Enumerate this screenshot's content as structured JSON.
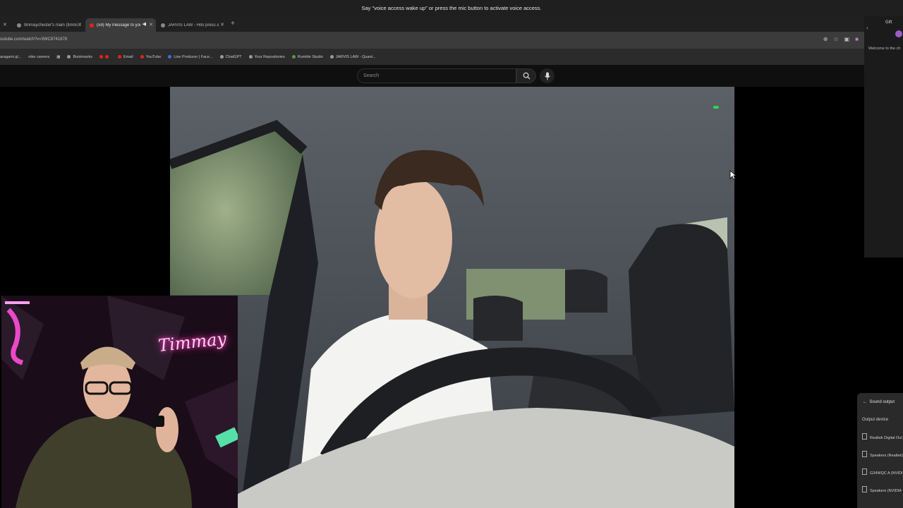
{
  "voice_bar": {
    "text": "Say \"voice access wake up\" or press the mic button to activate voice access."
  },
  "browser": {
    "tabs": [
      {
        "label": "timmaychester's main (timmi...",
        "active": false
      },
      {
        "label": "(59) My message to young ...",
        "active": true
      },
      {
        "label": "JARVIS LAW - Hito press at de...",
        "active": false
      }
    ],
    "url": "outube.com/watch?v=3WC8741678",
    "bookmarks": [
      "aragami gl...",
      "nike careers",
      "Bookmarks",
      "Email",
      "YouTube",
      "Live Producer | Face...",
      "ChatGPT",
      "Your Repositories",
      "Rumble Studio",
      "JARVIS LAW - Quant..."
    ]
  },
  "youtube": {
    "search_placeholder": "Search"
  },
  "side_panel": {
    "gift": "Gift",
    "welcome": "Welcome to the ch"
  },
  "sound_output": {
    "title": "Sound output",
    "section": "Output device",
    "devices": [
      "Realtek Digital Out",
      "Speakers (Realtek)",
      "G34WQC A (NVIDI",
      "Speakers (NVIDIA"
    ]
  },
  "webcam": {
    "neon_sign": "Timmay"
  },
  "colors": {
    "youtube_red": "#e62117",
    "chrome_bg": "#2b2b2b",
    "page_bg": "#0f0f0f"
  }
}
